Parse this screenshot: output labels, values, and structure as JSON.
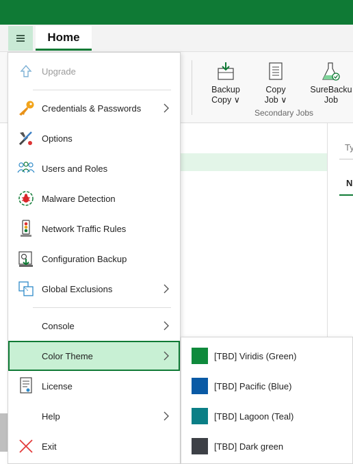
{
  "tabs": {
    "home": "Home"
  },
  "ribbon": {
    "buttons": [
      {
        "line1": "Backup",
        "line2": "Copy",
        "has_dropdown": true
      },
      {
        "line1": "Copy",
        "line2": "Job",
        "has_dropdown": true
      },
      {
        "line1": "SureBacku",
        "line2": "Job",
        "has_dropdown": false
      }
    ],
    "group_label": "Secondary Jobs"
  },
  "right_pane": {
    "type_label": "Ty",
    "name_col": "N"
  },
  "menu": {
    "items": [
      {
        "label": "Upgrade",
        "icon": "upgrade-arrow-icon",
        "disabled": true,
        "submenu": false
      },
      {
        "label": "Credentials & Passwords",
        "icon": "key-icon",
        "submenu": true
      },
      {
        "label": "Options",
        "icon": "tools-icon",
        "submenu": false
      },
      {
        "label": "Users and Roles",
        "icon": "users-icon",
        "submenu": false
      },
      {
        "label": "Malware Detection",
        "icon": "malware-bug-icon",
        "submenu": false
      },
      {
        "label": "Network Traffic Rules",
        "icon": "traffic-light-icon",
        "submenu": false
      },
      {
        "label": "Configuration Backup",
        "icon": "config-backup-icon",
        "submenu": false
      },
      {
        "label": "Global Exclusions",
        "icon": "global-exclusions-icon",
        "submenu": true
      },
      {
        "label": "Console",
        "icon": "",
        "submenu": true
      },
      {
        "label": "Color Theme",
        "icon": "",
        "submenu": true,
        "selected": true
      },
      {
        "label": "License",
        "icon": "license-icon",
        "submenu": false
      },
      {
        "label": "Help",
        "icon": "",
        "submenu": true
      },
      {
        "label": "Exit",
        "icon": "exit-x-icon",
        "submenu": false
      }
    ]
  },
  "color_theme_submenu": {
    "items": [
      {
        "label": "[TBD] Viridis (Green)",
        "color": "#0f8a3c"
      },
      {
        "label": "[TBD] Pacific (Blue)",
        "color": "#0a5aa5"
      },
      {
        "label": "[TBD] Lagoon (Teal)",
        "color": "#0b7f86"
      },
      {
        "label": "[TBD] Dark green",
        "color": "#3d4046"
      }
    ]
  },
  "colors": {
    "brand_green": "#0f7a35",
    "selected_bg": "#c8f0d4",
    "selection_row": "#e3f5e8"
  }
}
